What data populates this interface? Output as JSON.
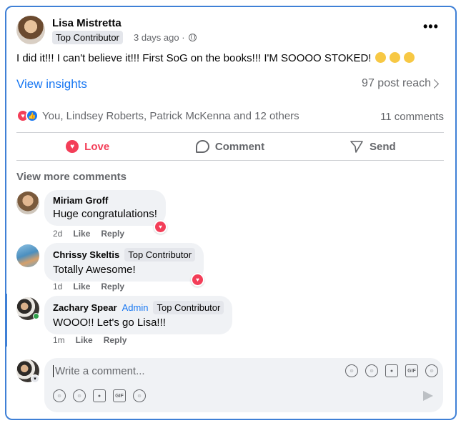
{
  "post": {
    "author": "Lisa Mistretta",
    "badge": "Top Contributor",
    "time": "3 days ago ·",
    "text": "I did it!!! I can't believe it!!! First SoG on the books!!! I'M SOOOO STOKED!",
    "emojis": [
      "upside-down-face",
      "grinning-face",
      "zany-face"
    ],
    "more_label": "•••"
  },
  "insights": {
    "link": "View insights",
    "reach": "97 post reach"
  },
  "reactions": {
    "names": "You, Lindsey Roberts, Patrick McKenna and 12 others",
    "comments_count": "11 comments"
  },
  "actions": {
    "love": "Love",
    "comment": "Comment",
    "send": "Send"
  },
  "view_more": "View more comments",
  "comments": [
    {
      "name": "Miriam Groff",
      "badge": "",
      "admin": "",
      "text": "Huge congratulations!",
      "time": "2d",
      "like": "Like",
      "reply": "Reply",
      "loved": true
    },
    {
      "name": "Chrissy Skeltis",
      "badge": "Top Contributor",
      "admin": "",
      "text": "Totally Awesome!",
      "time": "1d",
      "like": "Like",
      "reply": "Reply",
      "loved": true
    },
    {
      "name": "Zachary Spear",
      "badge": "Top Contributor",
      "admin": "Admin",
      "text": "WOOO!! Let's go Lisa!!!",
      "time": "1m",
      "like": "Like",
      "reply": "Reply",
      "loved": false
    }
  ],
  "composer": {
    "placeholder": "Write a comment...",
    "tools": [
      "avatar-sticker-icon",
      "emoji-icon",
      "camera-icon",
      "gif-icon",
      "sticker-icon"
    ]
  },
  "colors": {
    "accent": "#1877f2",
    "love": "#f33e58",
    "focus_border": "#3f80d6"
  }
}
